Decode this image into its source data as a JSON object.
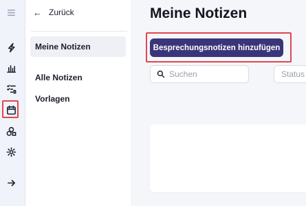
{
  "sidebar_rail": {
    "icons": [
      "menu-icon",
      "bolt-icon",
      "chart-icon",
      "checklist-icon",
      "calendar-icon",
      "shapes-icon",
      "gear-icon",
      "arrow-right-icon"
    ],
    "selected": "calendar-icon",
    "highlight_color": "#e2454f"
  },
  "subnav": {
    "back_label": "Zurück",
    "items": [
      {
        "label": "Meine Notizen",
        "active": true
      },
      {
        "label": "Alle Notizen",
        "active": false
      },
      {
        "label": "Vorlagen",
        "active": false
      }
    ]
  },
  "main": {
    "title": "Meine Notizen",
    "add_button_label": "Besprechungsnotizen hinzufügen",
    "search_placeholder": "Suchen",
    "status_filter_label": "Status"
  },
  "colors": {
    "accent": "#3a3579",
    "highlight": "#e2454f"
  }
}
